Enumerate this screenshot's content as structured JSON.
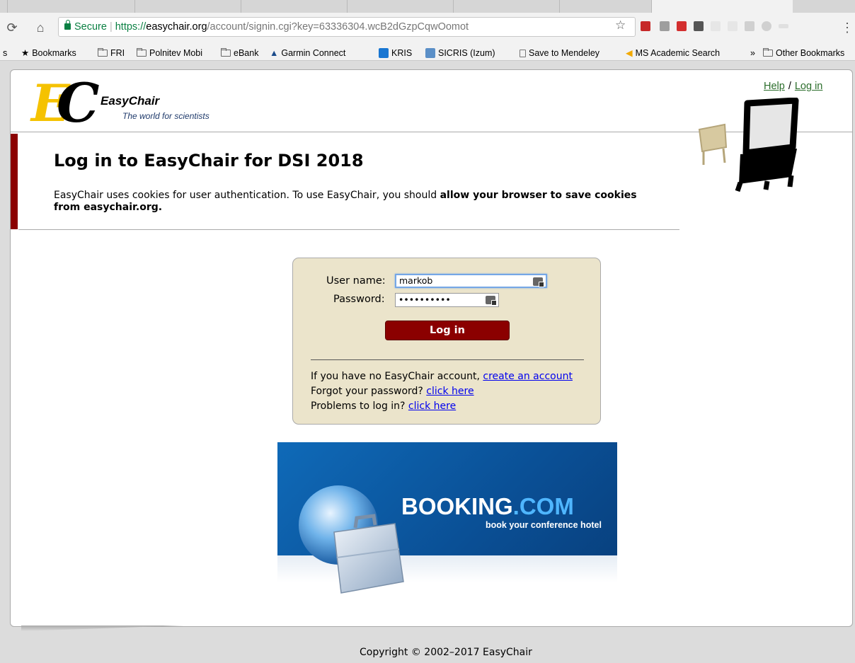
{
  "browser": {
    "url": {
      "secure_label": "Secure",
      "scheme": "https://",
      "host": "easychair.org",
      "path": "/account/signin.cgi?key=63336304.wcB2dGzpCqwOomot"
    },
    "bookmarks": [
      {
        "label": "Bookmarks",
        "icon": "star-icon"
      },
      {
        "label": "FRI",
        "icon": "folder-icon"
      },
      {
        "label": "Polnitev Mobi",
        "icon": "folder-icon"
      },
      {
        "label": "eBank",
        "icon": "folder-icon"
      },
      {
        "label": "Garmin Connect",
        "icon": "triangle-icon"
      },
      {
        "label": "KRIS",
        "icon": "kris-icon"
      },
      {
        "label": "SICRIS (Izum)",
        "icon": "sicris-icon"
      },
      {
        "label": "Save to Mendeley",
        "icon": "page-icon"
      },
      {
        "label": "MS Academic Search",
        "icon": "ms-academic-icon"
      },
      {
        "label": "»",
        "icon": ""
      },
      {
        "label": "Other Bookmarks",
        "icon": "folder-icon"
      }
    ]
  },
  "header": {
    "logo_name": "EasyChair",
    "logo_tagline": "The world for scientists",
    "help_link": "Help",
    "separator": "/",
    "login_link": "Log in"
  },
  "main": {
    "title": "Log in to EasyChair for DSI 2018",
    "notice_text": "EasyChair uses cookies for user authentication. To use EasyChair, you should ",
    "notice_bold": "allow your browser to save cookies from easychair.org."
  },
  "login": {
    "username_label": "User name:",
    "username_value": "markob",
    "password_label": "Password:",
    "password_value": "••••••••••",
    "button_label": "Log in",
    "no_account_text": "If you have no EasyChair account, ",
    "create_account_link": "create an account",
    "forgot_text": "Forgot your password? ",
    "forgot_link": "click here",
    "problems_text": "Problems to log in? ",
    "problems_link": "click here"
  },
  "ad": {
    "brand_main": "BOOKING",
    "brand_suffix": ".COM",
    "slogan": "book your conference hotel"
  },
  "footer": {
    "copyright": "Copyright © 2002–2017 EasyChair"
  },
  "colors": {
    "accent_red": "#8b0000",
    "login_box_bg": "#ebe4cb",
    "link_green": "#2c6e2c",
    "secure_green": "#0b8043",
    "ad_blue": "#0a4f95"
  }
}
